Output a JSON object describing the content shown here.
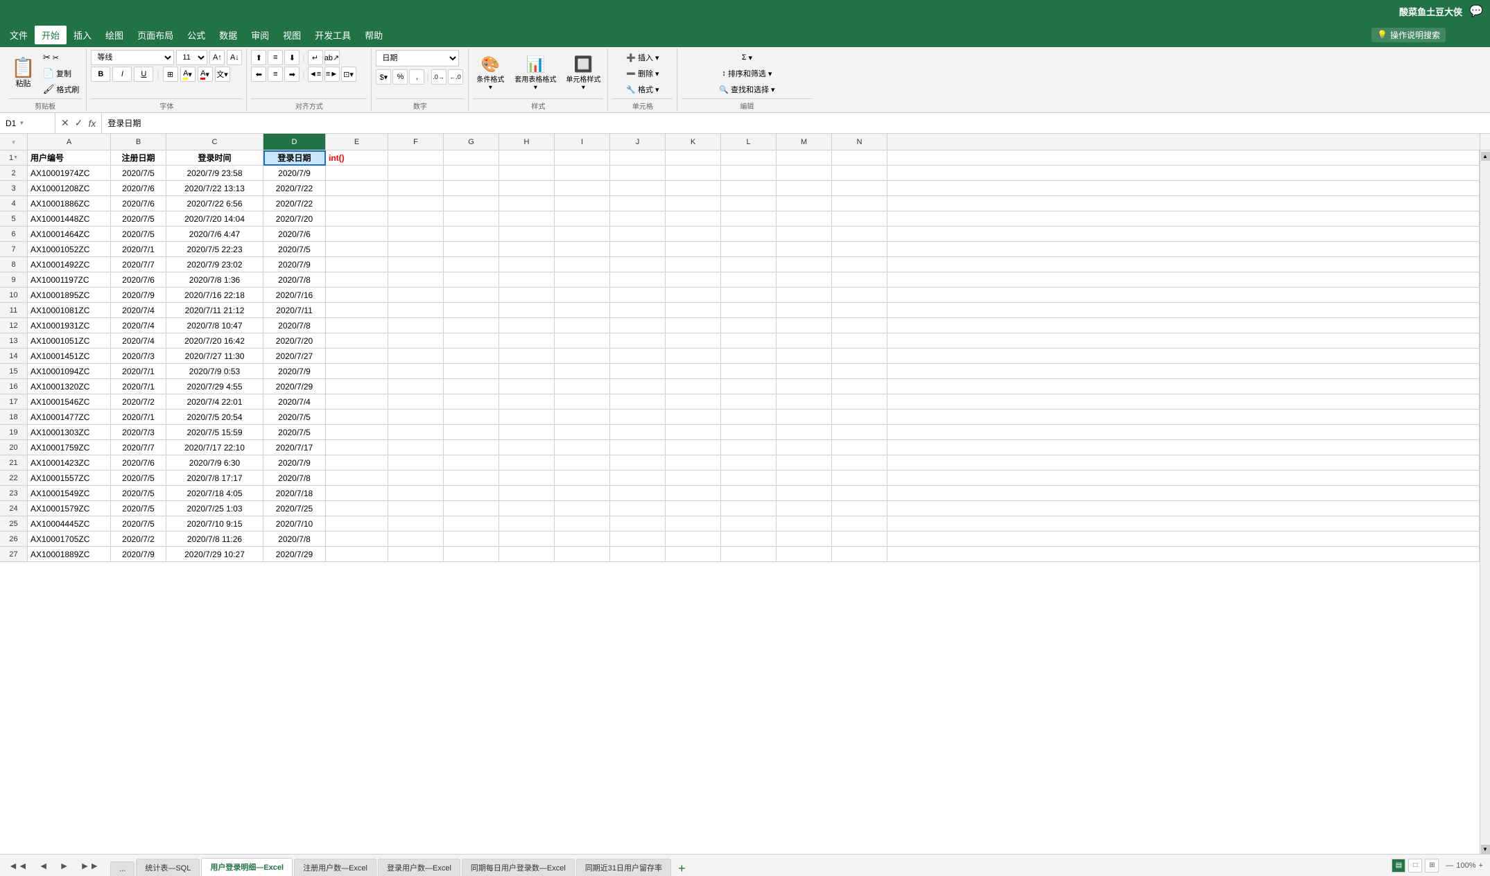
{
  "titleBar": {
    "username": "酸菜鱼土豆大侠",
    "chatIcon": "💬"
  },
  "menuBar": {
    "items": [
      {
        "label": "文件",
        "active": false
      },
      {
        "label": "开始",
        "active": true
      },
      {
        "label": "插入",
        "active": false
      },
      {
        "label": "绘图",
        "active": false
      },
      {
        "label": "页面布局",
        "active": false
      },
      {
        "label": "公式",
        "active": false
      },
      {
        "label": "数据",
        "active": false
      },
      {
        "label": "审阅",
        "active": false
      },
      {
        "label": "视图",
        "active": false
      },
      {
        "label": "开发工具",
        "active": false
      },
      {
        "label": "帮助",
        "active": false
      }
    ],
    "searchPlaceholder": "操作说明搜索",
    "helpIcon": "💡"
  },
  "ribbon": {
    "clipboard": {
      "label": "剪贴板",
      "paste": "粘贴",
      "cut": "✂",
      "copy": "📋",
      "formatPainter": "🖌"
    },
    "font": {
      "label": "字体",
      "fontName": "等线",
      "fontSize": "11",
      "bold": "B",
      "italic": "I",
      "underline": "U",
      "border": "⊞",
      "fillColor": "A",
      "fontColor": "A"
    },
    "alignment": {
      "label": "对齐方式",
      "topAlign": "⊤",
      "middleAlign": "≡",
      "bottomAlign": "⊥",
      "leftAlign": "≡",
      "centerAlign": "≡",
      "rightAlign": "≡",
      "wrapText": "↵",
      "mergeCenter": "⊡"
    },
    "number": {
      "label": "数字",
      "format": "日期",
      "percent": "%",
      "comma": ",",
      "increaseDecimal": ".0→",
      "decreaseDecimal": "←.0"
    },
    "styles": {
      "label": "样式",
      "conditional": "条件格式",
      "tableFormat": "套用表格格式",
      "cellStyles": "单元格样式"
    },
    "cells": {
      "label": "单元格",
      "insert": "插入",
      "delete": "删除",
      "format": "格式"
    },
    "editing": {
      "label": "编辑",
      "sum": "Σ",
      "fill": "↓",
      "clear": "◫",
      "sortFilter": "排序和筛选",
      "findSelect": "查找和选择"
    }
  },
  "formulaBar": {
    "cellRef": "D1",
    "formula": "登录日期"
  },
  "columns": [
    {
      "label": "A",
      "class": "col-A"
    },
    {
      "label": "B",
      "class": "col-B"
    },
    {
      "label": "C",
      "class": "col-C"
    },
    {
      "label": "D",
      "class": "col-D",
      "selected": true
    },
    {
      "label": "E",
      "class": "col-E"
    },
    {
      "label": "F",
      "class": "col-F"
    },
    {
      "label": "G",
      "class": "col-G"
    },
    {
      "label": "H",
      "class": "col-H"
    },
    {
      "label": "I",
      "class": "col-I"
    },
    {
      "label": "J",
      "class": "col-J"
    },
    {
      "label": "K",
      "class": "col-K"
    },
    {
      "label": "L",
      "class": "col-L"
    },
    {
      "label": "M",
      "class": "col-M"
    },
    {
      "label": "N",
      "class": "col-N"
    }
  ],
  "rows": [
    {
      "num": 1,
      "cells": [
        "用户编号",
        "注册日期",
        "登录时间",
        "登录日期",
        "int()",
        "",
        "",
        "",
        "",
        "",
        "",
        "",
        "",
        ""
      ]
    },
    {
      "num": 2,
      "cells": [
        "AX10001974ZC",
        "2020/7/5",
        "2020/7/9 23:58",
        "2020/7/9",
        "",
        "",
        "",
        "",
        "",
        "",
        "",
        "",
        "",
        ""
      ]
    },
    {
      "num": 3,
      "cells": [
        "AX10001208ZC",
        "2020/7/6",
        "2020/7/22 13:13",
        "2020/7/22",
        "",
        "",
        "",
        "",
        "",
        "",
        "",
        "",
        "",
        ""
      ]
    },
    {
      "num": 4,
      "cells": [
        "AX10001886ZC",
        "2020/7/6",
        "2020/7/22 6:56",
        "2020/7/22",
        "",
        "",
        "",
        "",
        "",
        "",
        "",
        "",
        "",
        ""
      ]
    },
    {
      "num": 5,
      "cells": [
        "AX10001448ZC",
        "2020/7/5",
        "2020/7/20 14:04",
        "2020/7/20",
        "",
        "",
        "",
        "",
        "",
        "",
        "",
        "",
        "",
        ""
      ]
    },
    {
      "num": 6,
      "cells": [
        "AX10001464ZC",
        "2020/7/5",
        "2020/7/6 4:47",
        "2020/7/6",
        "",
        "",
        "",
        "",
        "",
        "",
        "",
        "",
        "",
        ""
      ]
    },
    {
      "num": 7,
      "cells": [
        "AX10001052ZC",
        "2020/7/1",
        "2020/7/5 22:23",
        "2020/7/5",
        "",
        "",
        "",
        "",
        "",
        "",
        "",
        "",
        "",
        ""
      ]
    },
    {
      "num": 8,
      "cells": [
        "AX10001492ZC",
        "2020/7/7",
        "2020/7/9 23:02",
        "2020/7/9",
        "",
        "",
        "",
        "",
        "",
        "",
        "",
        "",
        "",
        ""
      ]
    },
    {
      "num": 9,
      "cells": [
        "AX10001197ZC",
        "2020/7/6",
        "2020/7/8 1:36",
        "2020/7/8",
        "",
        "",
        "",
        "",
        "",
        "",
        "",
        "",
        "",
        ""
      ]
    },
    {
      "num": 10,
      "cells": [
        "AX10001895ZC",
        "2020/7/9",
        "2020/7/16 22:18",
        "2020/7/16",
        "",
        "",
        "",
        "",
        "",
        "",
        "",
        "",
        "",
        ""
      ]
    },
    {
      "num": 11,
      "cells": [
        "AX10001081ZC",
        "2020/7/4",
        "2020/7/11 21:12",
        "2020/7/11",
        "",
        "",
        "",
        "",
        "",
        "",
        "",
        "",
        "",
        ""
      ]
    },
    {
      "num": 12,
      "cells": [
        "AX10001931ZC",
        "2020/7/4",
        "2020/7/8 10:47",
        "2020/7/8",
        "",
        "",
        "",
        "",
        "",
        "",
        "",
        "",
        "",
        ""
      ]
    },
    {
      "num": 13,
      "cells": [
        "AX10001051ZC",
        "2020/7/4",
        "2020/7/20 16:42",
        "2020/7/20",
        "",
        "",
        "",
        "",
        "",
        "",
        "",
        "",
        "",
        ""
      ]
    },
    {
      "num": 14,
      "cells": [
        "AX10001451ZC",
        "2020/7/3",
        "2020/7/27 11:30",
        "2020/7/27",
        "",
        "",
        "",
        "",
        "",
        "",
        "",
        "",
        "",
        ""
      ]
    },
    {
      "num": 15,
      "cells": [
        "AX10001094ZC",
        "2020/7/1",
        "2020/7/9 0:53",
        "2020/7/9",
        "",
        "",
        "",
        "",
        "",
        "",
        "",
        "",
        "",
        ""
      ]
    },
    {
      "num": 16,
      "cells": [
        "AX10001320ZC",
        "2020/7/1",
        "2020/7/29 4:55",
        "2020/7/29",
        "",
        "",
        "",
        "",
        "",
        "",
        "",
        "",
        "",
        ""
      ]
    },
    {
      "num": 17,
      "cells": [
        "AX10001546ZC",
        "2020/7/2",
        "2020/7/4 22:01",
        "2020/7/4",
        "",
        "",
        "",
        "",
        "",
        "",
        "",
        "",
        "",
        ""
      ]
    },
    {
      "num": 18,
      "cells": [
        "AX10001477ZC",
        "2020/7/1",
        "2020/7/5 20:54",
        "2020/7/5",
        "",
        "",
        "",
        "",
        "",
        "",
        "",
        "",
        "",
        ""
      ]
    },
    {
      "num": 19,
      "cells": [
        "AX10001303ZC",
        "2020/7/3",
        "2020/7/5 15:59",
        "2020/7/5",
        "",
        "",
        "",
        "",
        "",
        "",
        "",
        "",
        "",
        ""
      ]
    },
    {
      "num": 20,
      "cells": [
        "AX10001759ZC",
        "2020/7/7",
        "2020/7/17 22:10",
        "2020/7/17",
        "",
        "",
        "",
        "",
        "",
        "",
        "",
        "",
        "",
        ""
      ]
    },
    {
      "num": 21,
      "cells": [
        "AX10001423ZC",
        "2020/7/6",
        "2020/7/9 6:30",
        "2020/7/9",
        "",
        "",
        "",
        "",
        "",
        "",
        "",
        "",
        "",
        ""
      ]
    },
    {
      "num": 22,
      "cells": [
        "AX10001557ZC",
        "2020/7/5",
        "2020/7/8 17:17",
        "2020/7/8",
        "",
        "",
        "",
        "",
        "",
        "",
        "",
        "",
        "",
        ""
      ]
    },
    {
      "num": 23,
      "cells": [
        "AX10001549ZC",
        "2020/7/5",
        "2020/7/18 4:05",
        "2020/7/18",
        "",
        "",
        "",
        "",
        "",
        "",
        "",
        "",
        "",
        ""
      ]
    },
    {
      "num": 24,
      "cells": [
        "AX10001579ZC",
        "2020/7/5",
        "2020/7/25 1:03",
        "2020/7/25",
        "",
        "",
        "",
        "",
        "",
        "",
        "",
        "",
        "",
        ""
      ]
    },
    {
      "num": 25,
      "cells": [
        "AX10004445ZC",
        "2020/7/5",
        "2020/7/10 9:15",
        "2020/7/10",
        "",
        "",
        "",
        "",
        "",
        "",
        "",
        "",
        "",
        ""
      ]
    },
    {
      "num": 26,
      "cells": [
        "AX10001705ZC",
        "2020/7/2",
        "2020/7/8 11:26",
        "2020/7/8",
        "",
        "",
        "",
        "",
        "",
        "",
        "",
        "",
        "",
        ""
      ]
    },
    {
      "num": 27,
      "cells": [
        "AX10001889ZC",
        "2020/7/9",
        "2020/7/29 10:27",
        "2020/7/29",
        "",
        "",
        "",
        "",
        "",
        "",
        "",
        "",
        "",
        ""
      ]
    }
  ],
  "sheets": [
    {
      "label": "...",
      "active": false
    },
    {
      "label": "统计表—SQL",
      "active": false
    },
    {
      "label": "用户登录明细—Excel",
      "active": true
    },
    {
      "label": "注册用户数—Excel",
      "active": false
    },
    {
      "label": "登录用户数—Excel",
      "active": false
    },
    {
      "label": "同期每日用户登录数—Excel",
      "active": false
    },
    {
      "label": "同期近31日用户留存率",
      "active": false
    }
  ],
  "statusBar": {
    "viewNormal": "▤",
    "viewPage": "□",
    "viewPageBreak": "⊞"
  }
}
